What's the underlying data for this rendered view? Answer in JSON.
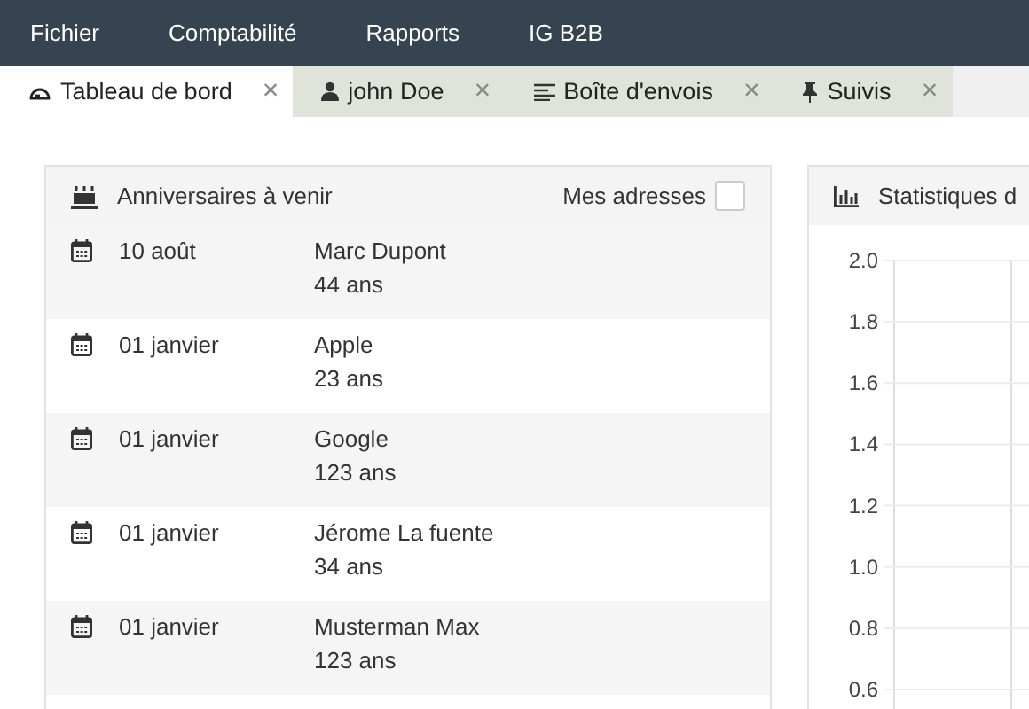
{
  "menu": [
    {
      "label": "Fichier"
    },
    {
      "label": "Comptabilité"
    },
    {
      "label": "Rapports"
    },
    {
      "label": "IG B2B"
    }
  ],
  "tabs": [
    {
      "label": "Tableau de bord",
      "selected": true,
      "close": "×"
    },
    {
      "label": "john Doe",
      "selected": false,
      "close": "×"
    },
    {
      "label": "Boîte d'envois",
      "selected": false,
      "close": "×"
    },
    {
      "label": "Suivis",
      "selected": false,
      "close": "×"
    }
  ],
  "birthdays": {
    "title": "Anniversaires à venir",
    "filter": {
      "label": "Mes adresses",
      "checked": false
    },
    "rows": [
      {
        "date": "10 août",
        "name": "Marc Dupont",
        "age": "44 ans"
      },
      {
        "date": "01 janvier",
        "name": "Apple",
        "age": "23 ans"
      },
      {
        "date": "01 janvier",
        "name": "Google",
        "age": "123 ans"
      },
      {
        "date": "01 janvier",
        "name": "Jérome La fuente",
        "age": "34 ans"
      },
      {
        "date": "01 janvier",
        "name": "Musterman Max",
        "age": "123 ans"
      }
    ]
  },
  "stats": {
    "title": "Statistiques d",
    "axis_labels": [
      "2.0",
      "1.8",
      "1.6",
      "1.4",
      "1.2",
      "1.0",
      "0.8",
      "0.6"
    ]
  }
}
